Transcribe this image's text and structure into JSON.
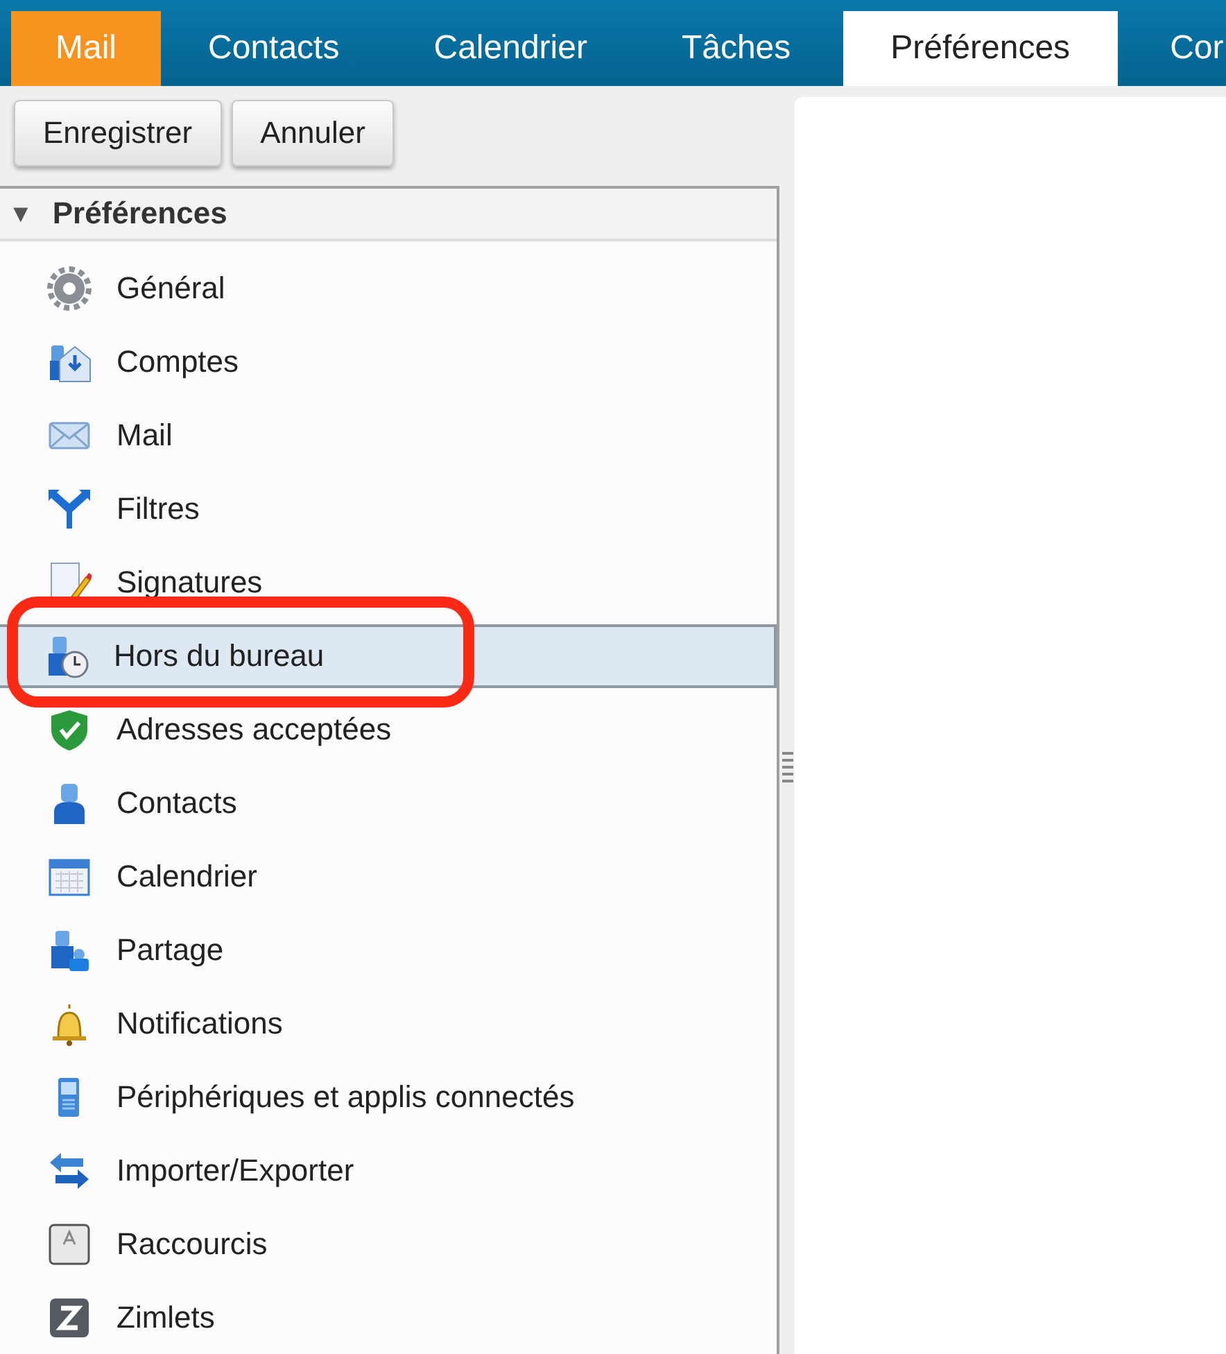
{
  "tabs": [
    {
      "label": "Mail",
      "selected": false,
      "kind": "app"
    },
    {
      "label": "Contacts",
      "selected": false
    },
    {
      "label": "Calendrier",
      "selected": false
    },
    {
      "label": "Tâches",
      "selected": false
    },
    {
      "label": "Préférences",
      "selected": true
    },
    {
      "label": "Cor",
      "selected": false
    }
  ],
  "toolbar": {
    "buttons": [
      "Enregistrer",
      "Annuler"
    ]
  },
  "tree": {
    "label": "Préférences",
    "expanded": true,
    "toggle": "▼",
    "items": [
      {
        "label": "Général",
        "selected": false,
        "annotated": false
      },
      {
        "label": "Comptes",
        "selected": false,
        "annotated": false
      },
      {
        "label": "Mail",
        "selected": false,
        "annotated": false
      },
      {
        "label": "Filtres",
        "selected": false,
        "annotated": false
      },
      {
        "label": "Signatures",
        "selected": false,
        "annotated": false
      },
      {
        "label": "Hors du bureau",
        "selected": true,
        "annotated": true
      },
      {
        "label": "Adresses acceptées",
        "selected": false,
        "annotated": false
      },
      {
        "label": "Contacts",
        "selected": false,
        "annotated": false
      },
      {
        "label": "Calendrier",
        "selected": false,
        "annotated": false
      },
      {
        "label": "Partage",
        "selected": false,
        "annotated": false
      },
      {
        "label": "Notifications",
        "selected": false,
        "annotated": false
      },
      {
        "label": "Périphériques et applis connectés",
        "selected": false,
        "annotated": false
      },
      {
        "label": "Importer/Exporter",
        "selected": false,
        "annotated": false
      },
      {
        "label": "Raccourcis",
        "selected": false,
        "annotated": false
      },
      {
        "label": "Zimlets",
        "selected": false,
        "annotated": false
      }
    ]
  }
}
